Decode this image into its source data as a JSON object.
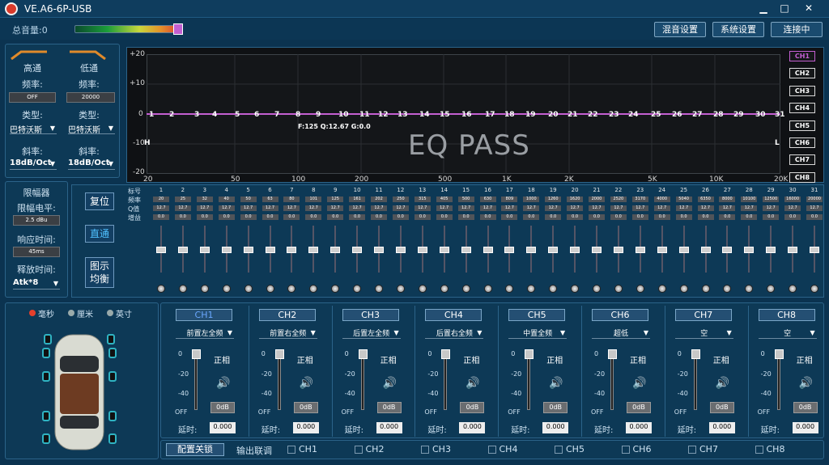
{
  "app": {
    "title": "VE.A6-6P-USB",
    "min": "▁",
    "max": "□",
    "close": "✕"
  },
  "top": {
    "volume_label": "总音量:0",
    "volume_level": 0.95,
    "btn_mix": "混音设置",
    "btn_sys": "系统设置",
    "btn_conn": "连接中"
  },
  "filter": {
    "hp": {
      "title": "高通",
      "freq_label": "频率:",
      "freq": "OFF",
      "type_label": "类型:",
      "type": "巴特沃斯",
      "slope_label": "斜率:",
      "slope": "18dB/Oct"
    },
    "lp": {
      "title": "低通",
      "freq_label": "频率:",
      "freq": "20000",
      "type_label": "类型:",
      "type": "巴特沃斯",
      "slope_label": "斜率:",
      "slope": "18dB/Oct"
    }
  },
  "limiter": {
    "title": "限幅器",
    "level_label": "限幅电平:",
    "level": "2.5 dBu",
    "resp_label": "响应时间:",
    "resp": "45ms",
    "release_label": "释放时间:",
    "release": "Atk*8"
  },
  "eqbtns": {
    "reset": "复位",
    "bypass": "直通",
    "graph": "图示",
    "graph2": "均衡"
  },
  "graph": {
    "ylabels": [
      "+20",
      "+10",
      "0",
      "-10",
      "-20"
    ],
    "xlabels": [
      "20",
      "50",
      "100",
      "200",
      "500",
      "1K",
      "2K",
      "5K",
      "10K",
      "20K"
    ],
    "eqpass": "EQ PASS",
    "fqg": "F:125 Q:12.67 G:0.0",
    "h": "H",
    "l": "L",
    "channels": [
      "CH1",
      "CH2",
      "CH3",
      "CH4",
      "CH5",
      "CH6",
      "CH7",
      "CH8"
    ]
  },
  "bands": {
    "row_labels": [
      "标号",
      "频率",
      "Q值",
      "增益"
    ],
    "nums": [
      "1",
      "2",
      "3",
      "4",
      "5",
      "6",
      "7",
      "8",
      "9",
      "10",
      "11",
      "12",
      "13",
      "14",
      "15",
      "16",
      "17",
      "18",
      "19",
      "20",
      "21",
      "22",
      "23",
      "24",
      "25",
      "26",
      "27",
      "28",
      "29",
      "30",
      "31"
    ],
    "freqs": [
      "20",
      "25",
      "32",
      "40",
      "50",
      "63",
      "80",
      "101",
      "125",
      "161",
      "202",
      "250",
      "315",
      "405",
      "500",
      "630",
      "809",
      "1000",
      "1260",
      "1620",
      "2000",
      "2520",
      "3170",
      "4000",
      "5040",
      "6350",
      "8000",
      "10100",
      "12500",
      "16000",
      "20000"
    ],
    "q": "12.7",
    "gain": "0.0"
  },
  "car": {
    "units": [
      "毫秒",
      "厘米",
      "英寸"
    ]
  },
  "outputs": [
    {
      "ch": "CH1",
      "src": "前置左全频"
    },
    {
      "ch": "CH2",
      "src": "前置右全频"
    },
    {
      "ch": "CH3",
      "src": "后置左全频"
    },
    {
      "ch": "CH4",
      "src": "后置右全频"
    },
    {
      "ch": "CH5",
      "src": "中置全频"
    },
    {
      "ch": "CH6",
      "src": "超低"
    },
    {
      "ch": "CH7",
      "src": "空"
    },
    {
      "ch": "CH8",
      "src": "空"
    }
  ],
  "out_common": {
    "phase": "正相",
    "db": "0dB",
    "delay_label": "延时:",
    "delay": "0.000",
    "scale": [
      "0",
      "-20",
      "-40",
      "OFF"
    ]
  },
  "bottom": {
    "config_lock": "配置关锁",
    "link_label": "输出联调",
    "chs": [
      "CH1",
      "CH2",
      "CH3",
      "CH4",
      "CH5",
      "CH6",
      "CH7",
      "CH8"
    ]
  },
  "colors": {
    "accent": "#c35fd1",
    "bg": "#0b3350",
    "panel": "#0d3956"
  }
}
